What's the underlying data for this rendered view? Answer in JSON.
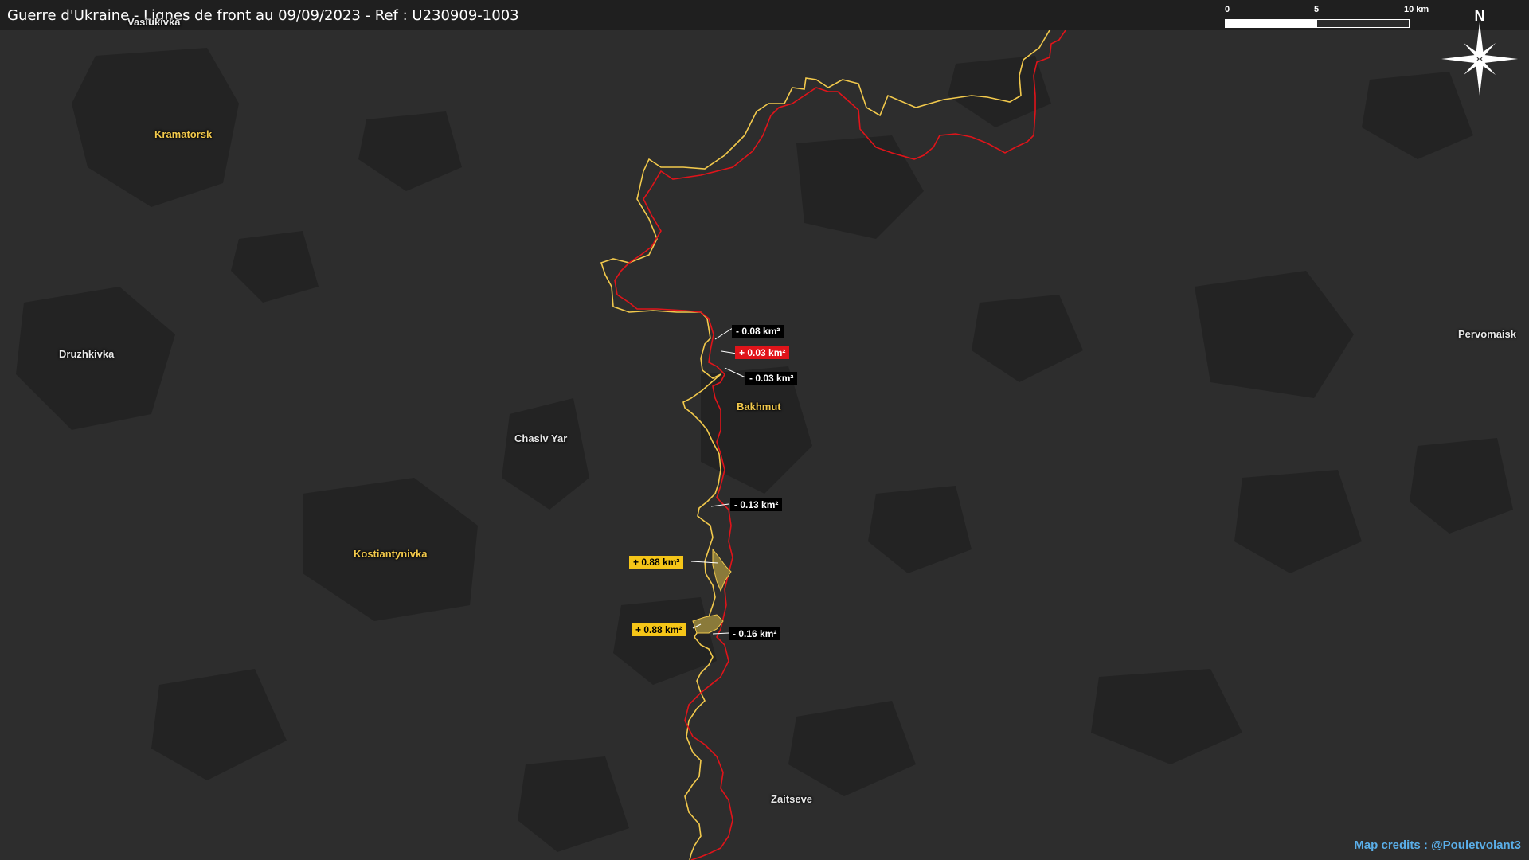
{
  "header": {
    "title": "Guerre d'Ukraine - Lignes de front au 09/09/2023 - Ref : U230909-1003"
  },
  "scale": {
    "tick_0": "0",
    "tick_5": "5",
    "tick_10": "10 km"
  },
  "compass": {
    "label": "N"
  },
  "cities": {
    "vasiukivka": "Vasiukivka",
    "kramatorsk": "Kramatorsk",
    "druzhkivka": "Druzhkivka",
    "chasiv_yar": "Chasiv Yar",
    "kostiantynivka": "Kostiantynivka",
    "bakhmut": "Bakhmut",
    "zaitseve": "Zaitseve",
    "pervomaisk": "Pervomaisk"
  },
  "area_changes": {
    "a1": "- 0.08 km²",
    "a2": "+ 0.03 km²",
    "a3": "- 0.03 km²",
    "a4": "- 0.13 km²",
    "a5": "+ 0.88 km²",
    "a6": "+ 0.88 km²",
    "a7": "- 0.16 km²"
  },
  "colors": {
    "background": "#2d2d2d",
    "urban_area": "#222222",
    "russian_line": "#e0141a",
    "ukrainian_line": "#f2c94c",
    "credits": "#5aaee8"
  },
  "credits": "Map credits : @Pouletvolant3"
}
